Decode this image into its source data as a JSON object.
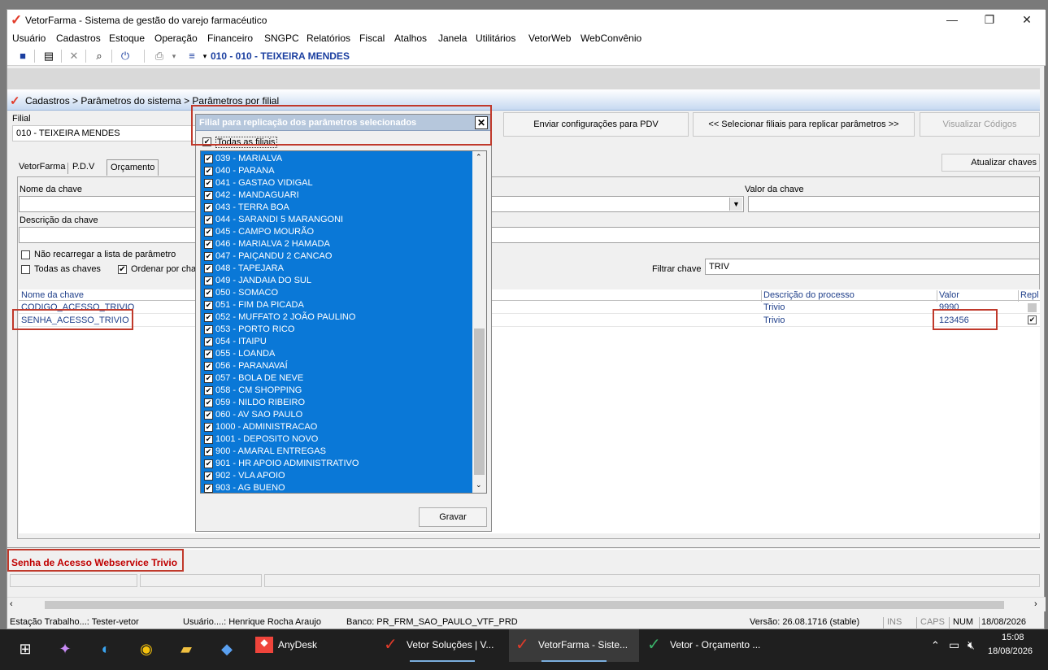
{
  "window": {
    "title": "VetorFarma - Sistema de gestão do varejo farmacéutico",
    "minimize": "—",
    "restore": "❐",
    "close": "✕"
  },
  "menu": [
    "Usuário",
    "Cadastros",
    "Estoque",
    "Operação",
    "Financeiro",
    "SNGPC",
    "Relatórios",
    "Fiscal",
    "Atalhos",
    "Janela",
    "Utilitários",
    "VetorWeb",
    "WebConvênio"
  ],
  "toolbar": {
    "filial": "010 - 010 - TEIXEIRA MENDES"
  },
  "breadcrumb": "Cadastros > Parâmetros do sistema > Parâmetros por filial",
  "form": {
    "filial_label": "Filial",
    "filial_value": "010 - TEIXEIRA MENDES",
    "btn_enviar": "Enviar configurações para  PDV",
    "btn_selecionar": "<< Selecionar filiais para replicar parâmetros >>",
    "btn_visualizar": "Visualizar Códigos",
    "btn_atualizar": "Atualizar chaves",
    "tabs": [
      "VetorFarma",
      "P.D.V",
      "Orçamento"
    ],
    "nome_chave_label": "Nome da chave",
    "valor_chave_label": "Valor da chave",
    "descricao_chave_label": "Descrição da chave",
    "nao_recarregar": "Não recarregar a lista de parâmetro",
    "todas_chaves": "Todas as chaves",
    "ordenar": "Ordenar por cha",
    "filtrar_label": "Filtrar chave",
    "filtrar_value": "TRIV"
  },
  "grid": {
    "headers": [
      "Nome da chave",
      "Descrição do processo",
      "Valor",
      "Repl"
    ],
    "rows": [
      {
        "nome": "CODIGO_ACESSO_TRIVIO",
        "processo": "Trivio",
        "valor": "9990",
        "repl": ""
      },
      {
        "nome": "SENHA_ACESSO_TRIVIO",
        "processo": "Trivio",
        "valor": "123456",
        "repl": "✔"
      }
    ]
  },
  "description": "Senha de Acesso Webservice Trivio",
  "dialog": {
    "title": "Filial para replicação dos parâmetros selecionados",
    "close": "✕",
    "todas_filiais": "Todas as filiais",
    "check": "✔",
    "items": [
      "039 - MARIALVA",
      "040 - PARANA",
      "041 - GASTAO VIDIGAL",
      "042 - MANDAGUARI",
      "043 - TERRA BOA",
      "044 - SARANDI 5 MARANGONI",
      "045 - CAMPO MOURÃO",
      "046 - MARIALVA 2 HAMADA",
      "047 - PAIÇANDU 2 CANCAO",
      "048 - TAPEJARA",
      "049 - JANDAIA DO SUL",
      "050 - SOMACO",
      "051 - FIM DA PICADA",
      "052 - MUFFATO 2 JOÃO PAULINO",
      "053 - PORTO RICO",
      "054 - ITAIPU",
      "055 - LOANDA",
      "056 - PARANAVAÍ",
      "057 - BOLA DE NEVE",
      "058 - CM SHOPPING",
      "059 - NILDO RIBEIRO",
      "060 - AV SAO PAULO",
      "1000 - ADMINISTRACAO",
      "1001 - DEPOSITO NOVO",
      "900 - AMARAL ENTREGAS",
      "901 - HR APOIO ADMINISTRATIVO",
      "902 - VLA APOIO",
      "903 - AG BUENO"
    ],
    "save": "Gravar"
  },
  "statusbar": {
    "estacao": "Estação Trabalho...:  Tester-vetor",
    "usuario": "Usuário....: Henrique Rocha Araujo",
    "banco": "Banco: PR_FRM_SAO_PAULO_VTF_PRD",
    "versao": "Versão: 26.08.1716 (stable)",
    "ins": "INS",
    "caps": "CAPS",
    "num": "NUM",
    "date": "18/08/2026"
  },
  "taskbar": {
    "apps": [
      "AnyDesk",
      "Vetor Soluções | V...",
      "VetorFarma - Siste...",
      "Vetor - Orçamento ..."
    ],
    "time": "15:08",
    "date": "18/08/2026"
  },
  "colors": {
    "accent_red": "#c0392b",
    "selection_blue": "#0a78d7",
    "link_blue": "#1f3f8a"
  }
}
